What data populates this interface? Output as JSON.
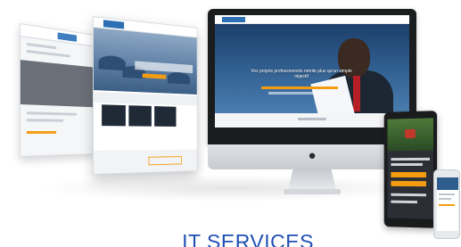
{
  "caption": {
    "text": "IT SERVICES",
    "color": "#1f4fb3"
  },
  "devices": {
    "desktop": {
      "brand_icon": "apple-icon",
      "hero_title": "Vos projets professionnels mérite plus qu'un simple objectif"
    },
    "tablet": {
      "play_icon": "video-play-icon"
    }
  },
  "colors": {
    "accent": "#f39c12",
    "site_blue": "#2d6fb3",
    "hero_blue": "#2e5c8d"
  }
}
